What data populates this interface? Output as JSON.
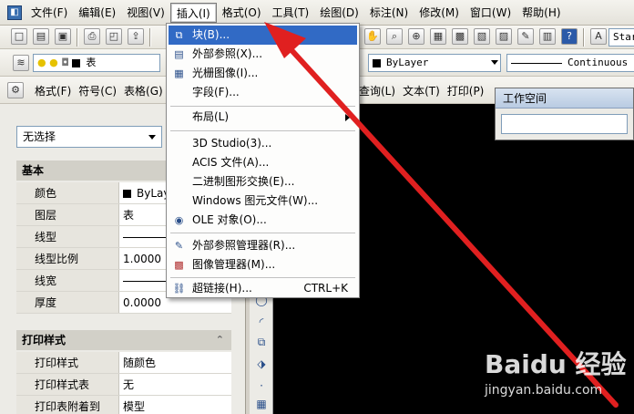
{
  "menubar": {
    "items": [
      "文件(F)",
      "编辑(E)",
      "视图(V)",
      "插入(I)",
      "格式(O)",
      "工具(T)",
      "绘图(D)",
      "标注(N)",
      "修改(M)",
      "窗口(W)",
      "帮助(H)"
    ],
    "active": "插入(I)"
  },
  "toolbar2": {
    "layer_value": "表",
    "linetype_value": "ByLayer",
    "lineweight_value": "Continuous",
    "style_value": "Star"
  },
  "toolbar3": {
    "items": [
      "格式(F)",
      "符号(C)",
      "表格(G)"
    ],
    "right_items": [
      "查询(L)",
      "文本(T)",
      "打印(P)"
    ]
  },
  "dropdown": {
    "items": [
      {
        "label": "块(B)...",
        "icon": "block-icon",
        "highlighted": true
      },
      {
        "label": "外部参照(X)...",
        "icon": "xref-icon"
      },
      {
        "label": "光栅图像(I)...",
        "icon": "raster-image-icon"
      },
      {
        "label": "字段(F)..."
      },
      {
        "label": "布局(L)",
        "submenu": true
      },
      {
        "label": "3D Studio(3)..."
      },
      {
        "label": "ACIS 文件(A)..."
      },
      {
        "label": "二进制图形交换(E)..."
      },
      {
        "label": "Windows 图元文件(W)..."
      },
      {
        "label": "OLE 对象(O)...",
        "icon": "ole-icon"
      },
      {
        "label": "外部参照管理器(R)...",
        "icon": "xref-manager-icon"
      },
      {
        "label": "图像管理器(M)...",
        "icon": "image-manager-icon"
      },
      {
        "label": "超链接(H)...",
        "icon": "hyperlink-icon",
        "shortcut": "CTRL+K"
      }
    ]
  },
  "palette": {
    "selection": "无选择",
    "groups": {
      "basic": "基本",
      "print": "打印样式"
    },
    "basic_rows": [
      {
        "label": "颜色",
        "value": "ByLay"
      },
      {
        "label": "图层",
        "value": "表"
      },
      {
        "label": "线型",
        "value": ""
      },
      {
        "label": "线型比例",
        "value": "1.0000"
      },
      {
        "label": "线宽",
        "value": ""
      },
      {
        "label": "厚度",
        "value": "0.0000"
      }
    ],
    "print_rows": [
      {
        "label": "打印样式",
        "value": "随颜色"
      },
      {
        "label": "打印样式表",
        "value": "无"
      },
      {
        "label": "打印表附着到",
        "value": "模型"
      }
    ]
  },
  "workspace": {
    "title": "工作空间"
  },
  "watermark": {
    "logo": "Baidu 经验",
    "url": "jingyan.baidu.com"
  },
  "colors": {
    "highlight": "#316ac5",
    "arrow": "#e02020",
    "drawing_bg": "#000000"
  }
}
